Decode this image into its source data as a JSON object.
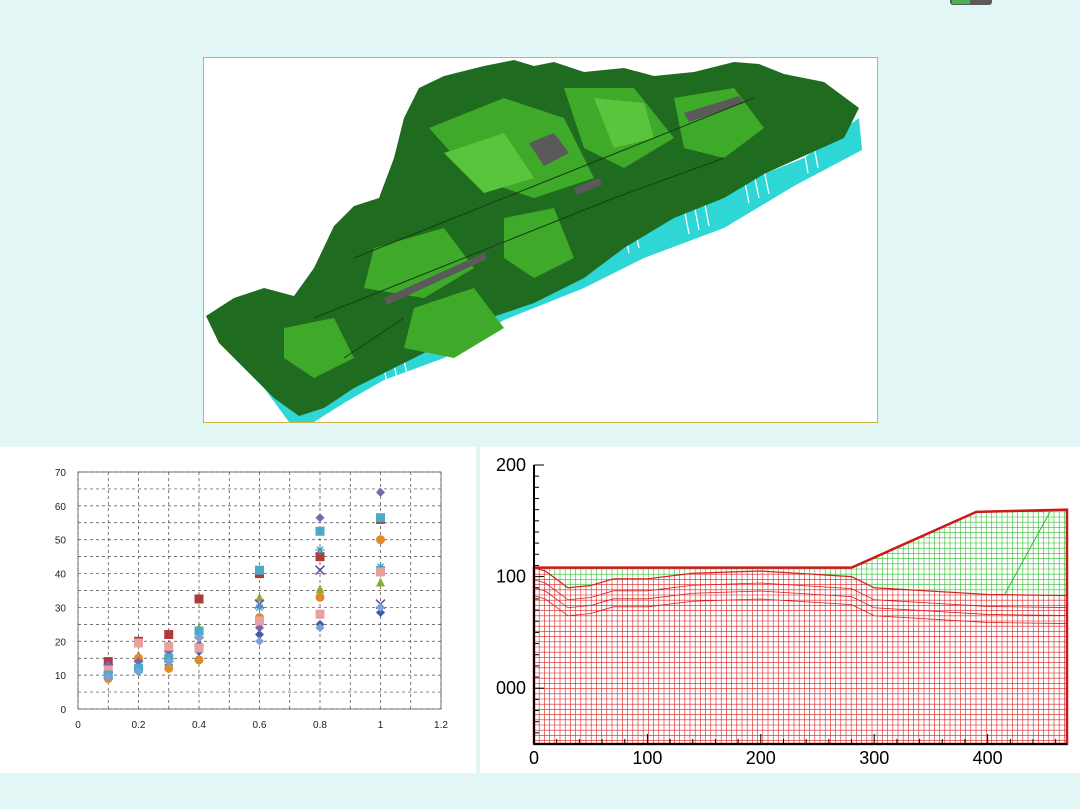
{
  "colors": {
    "background": "#e3f6f6",
    "terrain_dark": "#1f6b1f",
    "terrain_light": "#3faa2a",
    "terrain_base": "#2ed6d6",
    "mesh_upper": "#2bbf2b",
    "mesh_lower": "#d81f1f"
  },
  "chart_data": [
    {
      "type": "scatter",
      "xlim": [
        0,
        1.2
      ],
      "ylim": [
        0,
        70
      ],
      "x_ticks": [
        "0",
        "0.2",
        "0.4",
        "0.6",
        "0.8",
        "1",
        "1.2"
      ],
      "y_ticks": [
        "0",
        "10",
        "20",
        "30",
        "40",
        "50",
        "60",
        "70"
      ],
      "grid": "dashed",
      "series": [
        {
          "color": "#3a5ea8",
          "marker": "diamond",
          "points": [
            [
              0.1,
              10
            ],
            [
              0.2,
              11
            ],
            [
              0.3,
              13
            ],
            [
              0.4,
              17
            ],
            [
              0.6,
              22
            ],
            [
              0.8,
              25
            ],
            [
              1.0,
              28.5
            ]
          ]
        },
        {
          "color": "#b03a3a",
          "marker": "square",
          "points": [
            [
              0.1,
              14
            ],
            [
              0.2,
              20
            ],
            [
              0.3,
              22
            ],
            [
              0.4,
              32.5
            ],
            [
              0.6,
              40
            ],
            [
              0.8,
              45
            ],
            [
              1.0,
              56
            ]
          ]
        },
        {
          "color": "#8aaa3a",
          "marker": "triangle",
          "points": [
            [
              0.1,
              13
            ],
            [
              0.2,
              16
            ],
            [
              0.3,
              15
            ],
            [
              0.4,
              24
            ],
            [
              0.6,
              33
            ],
            [
              0.8,
              35.5
            ],
            [
              1.0,
              37.5
            ]
          ]
        },
        {
          "color": "#6a4aa0",
          "marker": "x",
          "points": [
            [
              0.1,
              12
            ],
            [
              0.2,
              13
            ],
            [
              0.3,
              16
            ],
            [
              0.4,
              20
            ],
            [
              0.6,
              31
            ],
            [
              0.8,
              41
            ],
            [
              1.0,
              31
            ]
          ]
        },
        {
          "color": "#3aa0c0",
          "marker": "star",
          "points": [
            [
              0.1,
              11
            ],
            [
              0.2,
              12
            ],
            [
              0.3,
              14
            ],
            [
              0.4,
              22
            ],
            [
              0.6,
              30
            ],
            [
              0.8,
              47
            ],
            [
              1.0,
              42
            ]
          ]
        },
        {
          "color": "#e08a2a",
          "marker": "circle",
          "points": [
            [
              0.1,
              9
            ],
            [
              0.2,
              15
            ],
            [
              0.3,
              12
            ],
            [
              0.4,
              14.5
            ],
            [
              0.6,
              27
            ],
            [
              0.8,
              33
            ],
            [
              1.0,
              50
            ]
          ]
        },
        {
          "color": "#7a66b0",
          "marker": "diamond",
          "points": [
            [
              0.1,
              13
            ],
            [
              0.2,
              14
            ],
            [
              0.3,
              17
            ],
            [
              0.4,
              19
            ],
            [
              0.6,
              24
            ],
            [
              0.8,
              56.5
            ],
            [
              1.0,
              64
            ]
          ]
        },
        {
          "color": "#e8a0a0",
          "marker": "square",
          "points": [
            [
              0.1,
              11.5
            ],
            [
              0.2,
              19.5
            ],
            [
              0.3,
              18.5
            ],
            [
              0.4,
              18
            ],
            [
              0.6,
              26
            ],
            [
              0.8,
              28
            ],
            [
              1.0,
              40.5
            ]
          ]
        },
        {
          "color": "#4aaac8",
          "marker": "square",
          "points": [
            [
              0.1,
              10
            ],
            [
              0.2,
              12
            ],
            [
              0.3,
              15
            ],
            [
              0.4,
              23
            ],
            [
              0.6,
              41
            ],
            [
              0.8,
              52.5
            ],
            [
              1.0,
              56.5
            ]
          ]
        },
        {
          "color": "#7fa0d0",
          "marker": "diamond",
          "points": [
            [
              0.1,
              9.5
            ],
            [
              0.2,
              11
            ],
            [
              0.3,
              14
            ],
            [
              0.4,
              21
            ],
            [
              0.6,
              20
            ],
            [
              0.8,
              24
            ],
            [
              1.0,
              30
            ]
          ]
        }
      ]
    },
    {
      "type": "mesh",
      "xlim": [
        0,
        470
      ],
      "ylim": [
        -50,
        200
      ],
      "x_ticks": [
        "0",
        "100",
        "200",
        "300",
        "400"
      ],
      "y_ticks": [
        {
          "value": 200,
          "label": "200"
        },
        {
          "value": 100,
          "label": "100"
        },
        {
          "value": 0,
          "label": "000"
        }
      ],
      "boundary": [
        [
          0,
          -50
        ],
        [
          0,
          108
        ],
        [
          50,
          108
        ],
        [
          160,
          108
        ],
        [
          280,
          108
        ],
        [
          390,
          158
        ],
        [
          470,
          160
        ],
        [
          470,
          -50
        ]
      ],
      "interface": [
        [
          0,
          108
        ],
        [
          10,
          105
        ],
        [
          30,
          90
        ],
        [
          50,
          92
        ],
        [
          70,
          98
        ],
        [
          100,
          98
        ],
        [
          140,
          103
        ],
        [
          200,
          105
        ],
        [
          280,
          100
        ],
        [
          300,
          90
        ],
        [
          400,
          84
        ],
        [
          470,
          83
        ]
      ]
    }
  ]
}
